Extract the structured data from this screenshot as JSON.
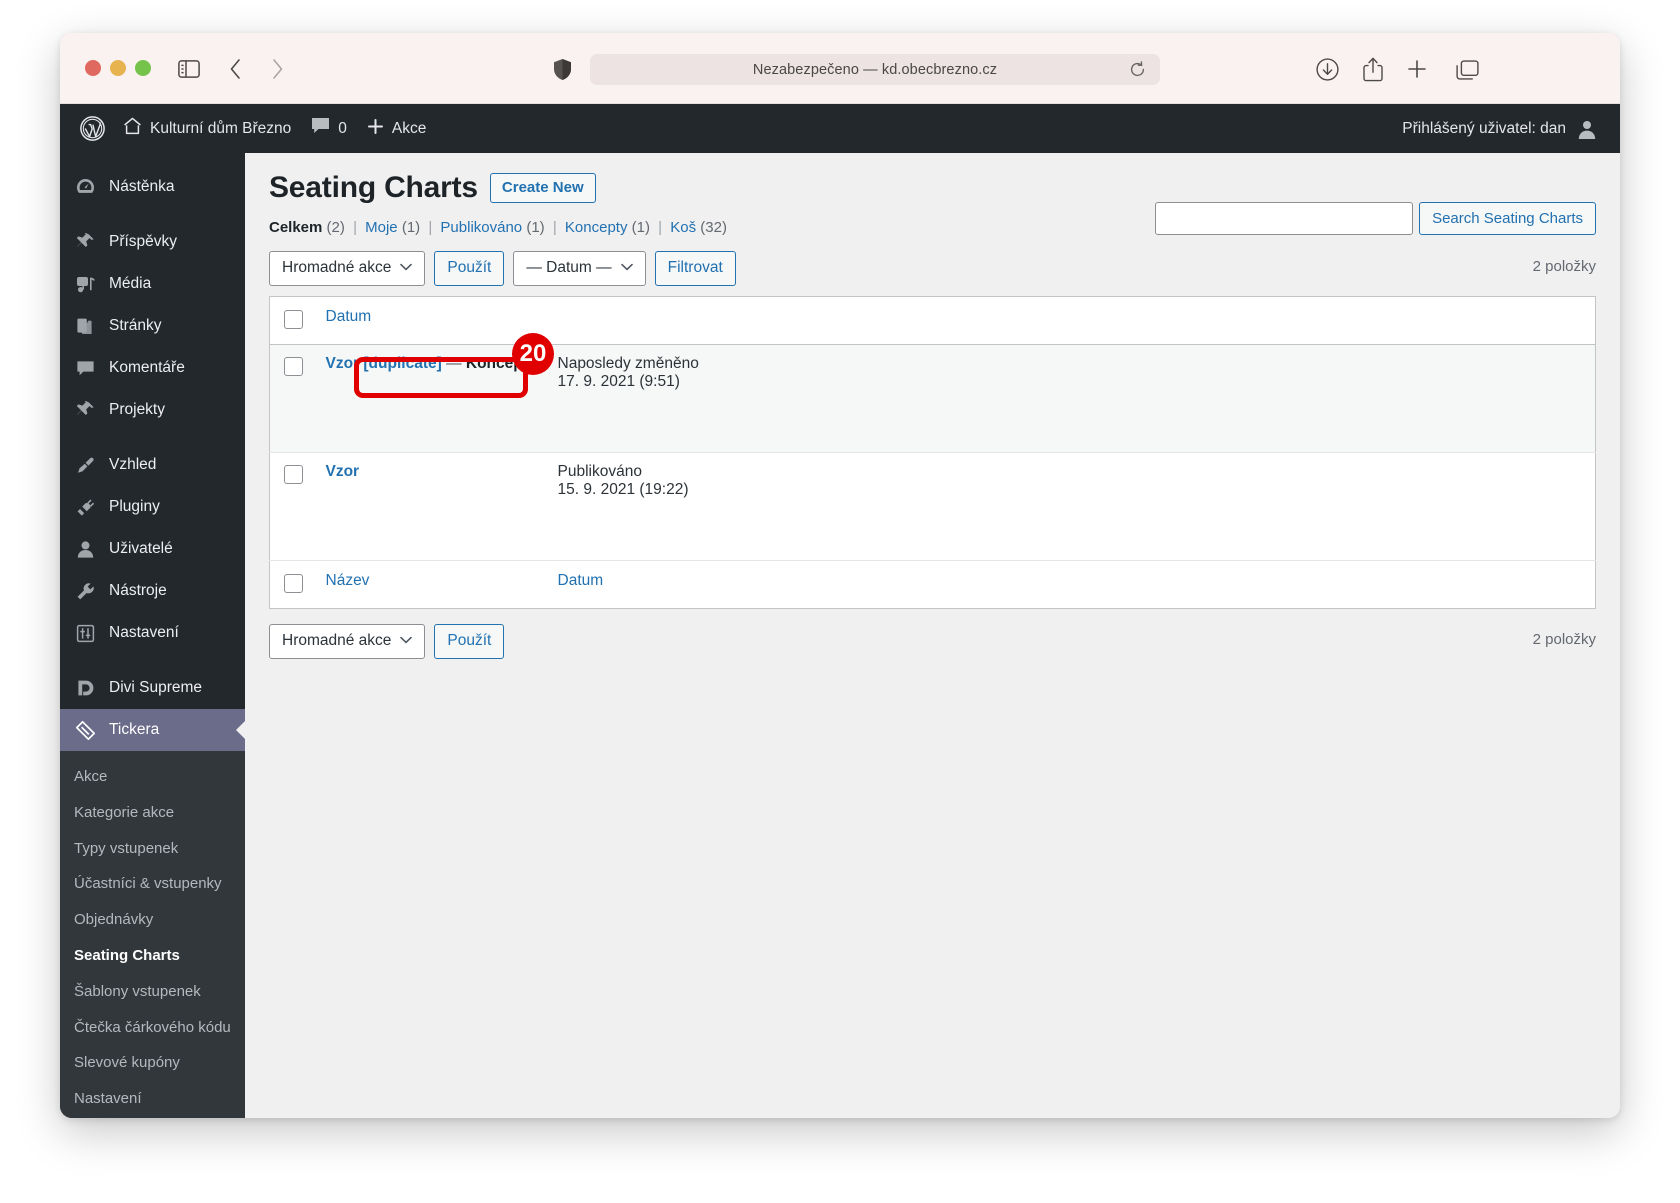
{
  "browser": {
    "url_text": "Nezabezpečeno — kd.obecbrezno.cz",
    "icons": {
      "sidebar_toggle": "sidebar-toggle-icon",
      "back": "chevron-left-icon",
      "forward": "chevron-right-icon",
      "shield": "shield-icon",
      "reload": "reload-icon",
      "download": "download-icon",
      "share": "share-icon",
      "new_tab": "plus-icon",
      "tab_overview": "tabs-icon"
    },
    "traffic_lights": {
      "close": "#e0695f",
      "minimize": "#e7b34e",
      "zoom": "#76c34b"
    }
  },
  "adminbar": {
    "site_name": "Kulturní dům Březno",
    "comments_count": "0",
    "new_label": "Akce",
    "account": "Přihlášený uživatel: dan"
  },
  "sidebar": {
    "items": [
      {
        "label": "Nástěnka",
        "icon": "dashboard-icon"
      },
      {
        "label": "Příspěvky",
        "icon": "pin-icon"
      },
      {
        "label": "Média",
        "icon": "media-icon"
      },
      {
        "label": "Stránky",
        "icon": "pages-icon"
      },
      {
        "label": "Komentáře",
        "icon": "comment-icon"
      },
      {
        "label": "Projekty",
        "icon": "pin-icon"
      },
      {
        "label": "Vzhled",
        "icon": "paintbrush-icon"
      },
      {
        "label": "Pluginy",
        "icon": "plug-icon"
      },
      {
        "label": "Uživatelé",
        "icon": "user-icon"
      },
      {
        "label": "Nástroje",
        "icon": "wrench-icon"
      },
      {
        "label": "Nastavení",
        "icon": "settings-icon"
      },
      {
        "label": "Divi Supreme",
        "icon": "divi-icon"
      },
      {
        "label": "Tickera",
        "icon": "ticket-icon"
      }
    ],
    "submenu": [
      {
        "label": "Akce"
      },
      {
        "label": "Kategorie akce"
      },
      {
        "label": "Typy vstupenek"
      },
      {
        "label": "Účastníci & vstupenky"
      },
      {
        "label": "Objednávky"
      },
      {
        "label": "Seating Charts"
      },
      {
        "label": "Šablony vstupenek"
      },
      {
        "label": "Čtečka čárkového kódu"
      },
      {
        "label": "Slevové kupóny"
      },
      {
        "label": "Nastavení"
      }
    ]
  },
  "page": {
    "title": "Seating Charts",
    "create_new": "Create New",
    "filters": [
      {
        "label": "Celkem",
        "count": "(2)",
        "current": true
      },
      {
        "label": "Moje",
        "count": "(1)",
        "current": false
      },
      {
        "label": "Publikováno",
        "count": "(1)",
        "current": false
      },
      {
        "label": "Koncepty",
        "count": "(1)",
        "current": false
      },
      {
        "label": "Koš",
        "count": "(32)",
        "current": false
      }
    ],
    "separator": "|"
  },
  "toolbar_top": {
    "bulk_actions": "Hromadné akce",
    "apply": "Použít",
    "date_filter": "— Datum —",
    "filter": "Filtrovat",
    "count": "2 položky"
  },
  "toolbar_bottom": {
    "bulk_actions": "Hromadné akce",
    "apply": "Použít",
    "count": "2 položky"
  },
  "search": {
    "value": "",
    "placeholder": "",
    "submit": "Search Seating Charts"
  },
  "table": {
    "head": {
      "cb": "",
      "title": "",
      "date": "Datum"
    },
    "foot": {
      "cb": "",
      "title": "Název",
      "date": "Datum"
    },
    "rows": [
      {
        "title": "Vzor [duplicate]",
        "dash": "—",
        "status": "Koncept",
        "date_label": "Naposledy změněno",
        "date_value": "17. 9. 2021 (9:51)"
      },
      {
        "title": "Vzor",
        "dash": "",
        "status": "",
        "date_label": "Publikováno",
        "date_value": "15. 9. 2021 (19:22)"
      }
    ]
  },
  "annotation": {
    "badge": "20",
    "color": "#e00000",
    "target": "Vzor [duplicate]"
  },
  "colors": {
    "wp_blue": "#2271b1",
    "admin_dark": "#23282d",
    "submenu_dark": "#32373c",
    "current_menu": "#6b6b8a",
    "content_bg": "#f0f0f1"
  }
}
